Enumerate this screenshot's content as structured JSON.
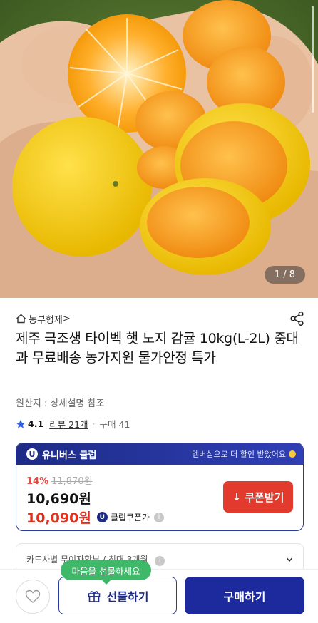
{
  "gallery": {
    "pager": "1 / 8"
  },
  "store": {
    "name": "농부형제",
    "chevron": ">"
  },
  "product": {
    "title": "제주 극조생 타이벡 햇 노지 감귤 10kg(L-2L) 중대과 무료배송 농가지원 물가안정 특가",
    "origin": "원산지 : 상세설명 참조",
    "rating": "4.1",
    "reviews": "리뷰 21개",
    "separator": "·",
    "purchases": "구매 41"
  },
  "club": {
    "badge": "U",
    "name": "유니버스 클럽",
    "note": "멤버십으로 더 할인 받았어요",
    "discount_pct": "14%",
    "original_price": "11,870원",
    "price": "10,690원",
    "club_price": "10,090원",
    "coupon_label": "클럽쿠폰가",
    "info": "i",
    "coupon_button": "쿠폰받기",
    "coupon_arrow": "↓"
  },
  "card_benefit": {
    "label": "카드사별 무이자할부 / 최대 3개월",
    "info": "i"
  },
  "bottom": {
    "tooltip": "마음을 선물하세요",
    "gift_label": "선물하기",
    "buy_label": "구매하기"
  },
  "colors": {
    "brand": "#1c2a9d",
    "coupon": "#e23a2c",
    "tooltip": "#3fb86a",
    "discount": "#e94a3f"
  }
}
